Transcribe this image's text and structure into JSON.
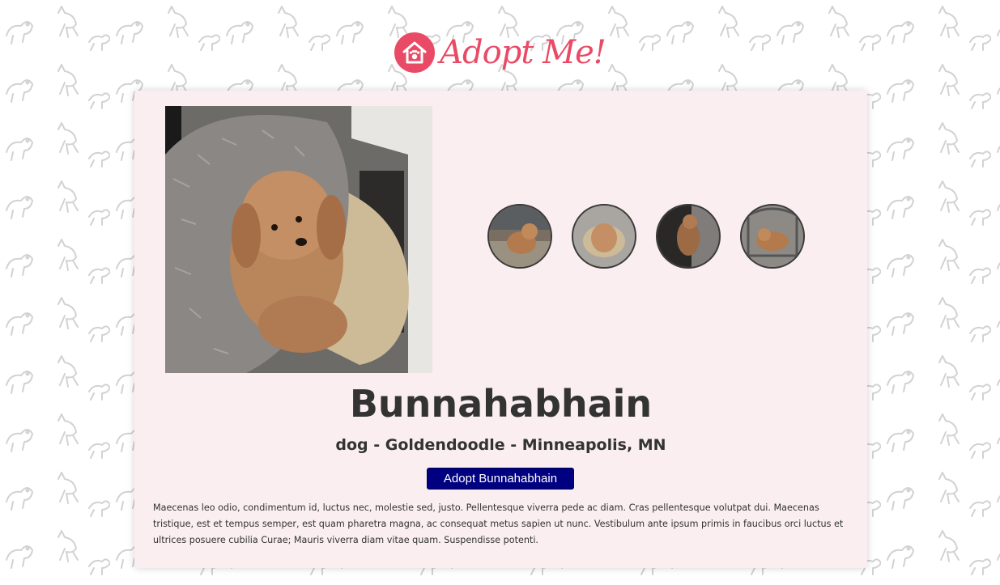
{
  "site": {
    "logo_text": "Adopt Me!",
    "brand_color": "#e94a66"
  },
  "pet": {
    "name": "Bunnahabhain",
    "meta": "dog - Goldendoodle - Minneapolis, MN",
    "adopt_label": "Adopt Bunnahabhain",
    "description": "Maecenas leo odio, condimentum id, luctus nec, molestie sed, justo. Pellentesque viverra pede ac diam. Cras pellentesque volutpat dui. Maecenas tristique, est et tempus semper, est quam pharetra magna, ac consequat metus sapien ut nunc. Vestibulum ante ipsum primis in faucibus orci luctus et ultrices posuere cubilia Curae; Mauris viverra diam vitae quam. Suspendisse potenti."
  },
  "colors": {
    "card_background": "#faeef0",
    "button_background": "#000080",
    "text": "#333333"
  },
  "gallery": {
    "thumbnail_count": 4
  }
}
